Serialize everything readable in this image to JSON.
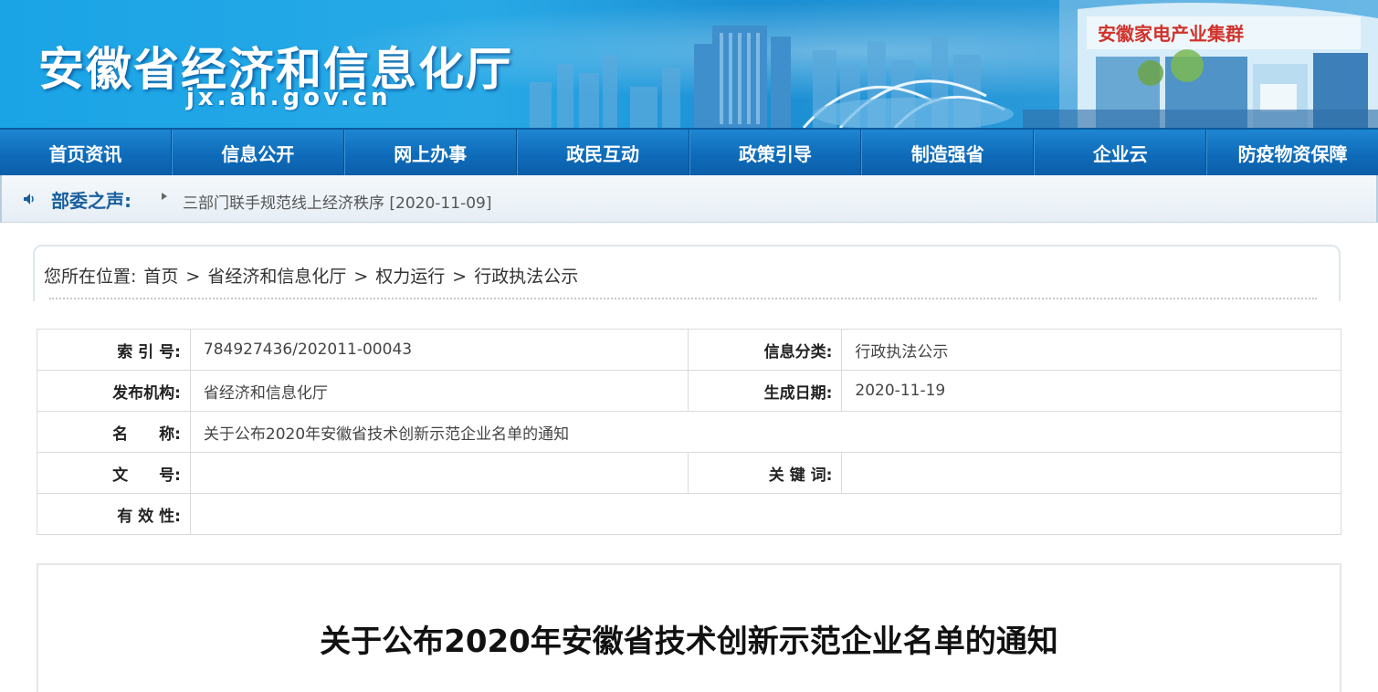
{
  "header": {
    "site_title": "安徽省经济和信息化厅",
    "site_domain": "jx.ah.gov.cn",
    "banner_sign": "安徽家电产业集群"
  },
  "nav": {
    "items": [
      "首页资讯",
      "信息公开",
      "网上办事",
      "政民互动",
      "政策引导",
      "制造强省",
      "企业云",
      "防疫物资保障"
    ]
  },
  "notice": {
    "label": "部委之声:",
    "news": "三部门联手规范线上经济秩序 [2020-11-09]"
  },
  "breadcrumb": {
    "prefix": "您所在位置:",
    "items": [
      "首页",
      "省经济和信息化厅",
      "权力运行",
      "行政执法公示"
    ],
    "separator": ">"
  },
  "info": {
    "index_label": "索 引 号:",
    "index_value": "784927436/202011-00043",
    "category_label": "信息分类:",
    "category_value": "行政执法公示",
    "publisher_label": "发布机构:",
    "publisher_value": "省经济和信息化厅",
    "date_label": "生成日期:",
    "date_value": "2020-11-19",
    "name_label": "名　　称:",
    "name_value": "关于公布2020年安徽省技术创新示范企业名单的通知",
    "docno_label": "文　　号:",
    "docno_value": "",
    "keywords_label": "关 键 词:",
    "keywords_value": "",
    "validity_label": "有 效 性:",
    "validity_value": ""
  },
  "article": {
    "title": "关于公布2020年安徽省技术创新示范企业名单的通知"
  }
}
